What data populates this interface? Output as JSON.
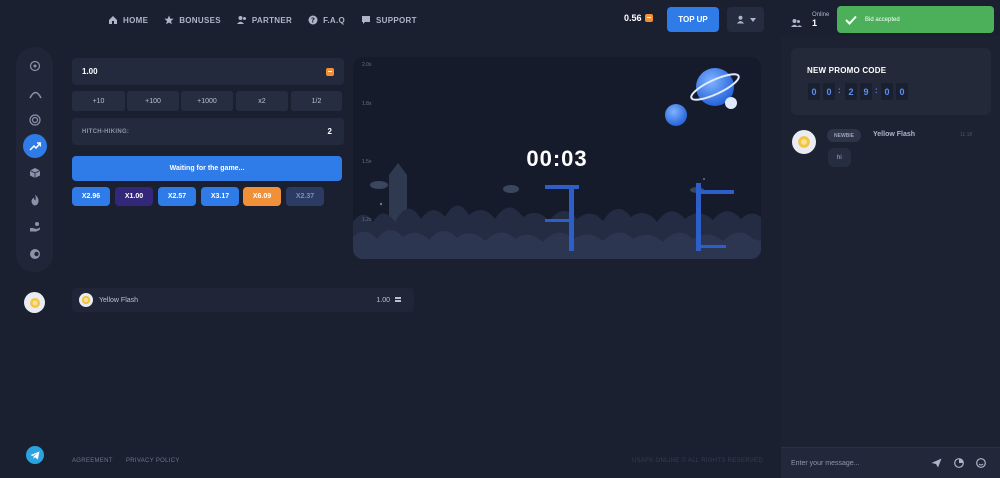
{
  "nav": {
    "items": [
      {
        "label": "HOME",
        "icon": "home-icon"
      },
      {
        "label": "BONUSES",
        "icon": "star-icon"
      },
      {
        "label": "PARTNER",
        "icon": "users-icon"
      },
      {
        "label": "F.A.Q",
        "icon": "question-icon"
      },
      {
        "label": "SUPPORT",
        "icon": "chat-icon"
      }
    ]
  },
  "header": {
    "balance": "0.56",
    "topup_label": "TOP UP",
    "online_label": "Online",
    "online_count": "1"
  },
  "toast": {
    "text": "Bid accepted"
  },
  "bet": {
    "amount": "1.00",
    "quick_buttons": [
      "+10",
      "+100",
      "+1000",
      "x2",
      "1/2"
    ],
    "hitch_label": "HITCH-HIKING:",
    "hitch_value": "2",
    "waiting_label": "Waiting for the game..."
  },
  "history": [
    {
      "label": "X2.96",
      "color": "#2f7be8"
    },
    {
      "label": "X1.00",
      "color": "#33277a"
    },
    {
      "label": "X2.57",
      "color": "#2f7be8"
    },
    {
      "label": "X3.17",
      "color": "#2f7be8"
    },
    {
      "label": "X6.09",
      "color": "#f0913a"
    },
    {
      "label": "X2.37",
      "color": "#2c3b63"
    }
  ],
  "game": {
    "timer": "00:03",
    "axis_labels": [
      "2.0x",
      "1.8x",
      "1.5x",
      "1.2x"
    ]
  },
  "bets_list": [
    {
      "name": "Yellow Flash",
      "amount": "1.00"
    }
  ],
  "footer": {
    "agreement": "AGREEMENT",
    "privacy": "PRIVACY POLICY",
    "copyright": "USAFK.ONLINE © ALL RIGHTS RESERVED"
  },
  "promo": {
    "title": "NEW PROMO CODE",
    "digits": [
      "0",
      "0",
      "2",
      "9",
      "0",
      "0"
    ]
  },
  "chat": {
    "message": {
      "badge": "NEWBIE",
      "name": "Yellow Flash",
      "time": "11:18",
      "text": "hi"
    },
    "input_placeholder": "Enter your message..."
  }
}
